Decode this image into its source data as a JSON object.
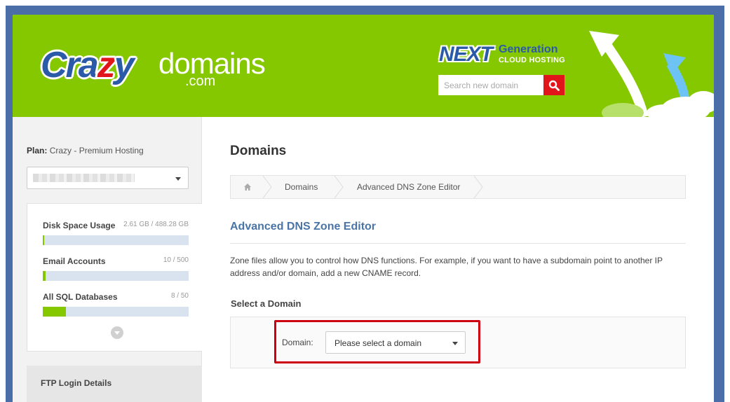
{
  "header": {
    "logo": {
      "crazy_prefix": "Cra",
      "crazy_z": "z",
      "crazy_suffix": "y",
      "domains": "domains",
      "com": ".com"
    },
    "promo": {
      "next": "NEXT",
      "generation": "Generation",
      "cloud": "CLOUD HOSTING"
    },
    "search": {
      "placeholder": "Search new domain",
      "icon": "search-icon"
    },
    "colors": {
      "header_bg": "#86c800",
      "brand_blue": "#2b5ba8",
      "brand_red": "#e0161a"
    }
  },
  "sidebar": {
    "plan_label": "Plan:",
    "plan_value": "Crazy - Premium Hosting",
    "usage": [
      {
        "label": "Disk Space Usage",
        "value": "2.61 GB / 488.28 GB",
        "fraction": 0.005
      },
      {
        "label": "Email Accounts",
        "value": "10 / 500",
        "fraction": 0.02
      },
      {
        "label": "All SQL Databases",
        "value": "8 / 50",
        "fraction": 0.16
      }
    ],
    "expand_icon": "chevron-down-icon",
    "ftp_label": "FTP Login Details"
  },
  "main": {
    "page_title": "Domains",
    "breadcrumb": {
      "home_icon": "home-icon",
      "items": [
        "Domains",
        "Advanced DNS Zone Editor"
      ]
    },
    "section_title": "Advanced DNS Zone Editor",
    "description": "Zone files allow you to control how DNS functions. For example, if you want to have a subdomain point to another IP address and/or domain, add a new CNAME record.",
    "select_heading": "Select a Domain",
    "domain_label": "Domain:",
    "domain_select_value": "Please select a domain",
    "highlight_color": "#cc0010"
  }
}
